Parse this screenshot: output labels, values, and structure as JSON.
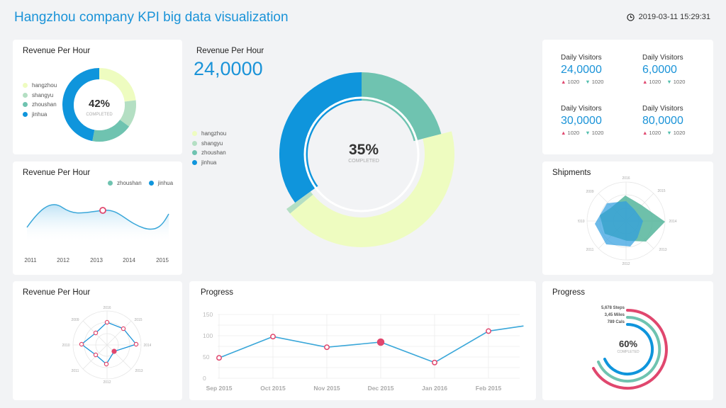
{
  "header": {
    "title": "Hangzhou company KPI big data visualization",
    "datetime": "2019-03-11 15:29:31"
  },
  "colors": {
    "hangzhou": "#eefcc0",
    "shangyu": "#b4dfc3",
    "zhoushan": "#6fc3b0",
    "jinhua": "#0f95dc",
    "accent": "#1a93d8",
    "pink": "#e0476e"
  },
  "legend": [
    "hangzhou",
    "shangyu",
    "zhoushan",
    "jinhua"
  ],
  "card_donut_small": {
    "title": "Revenue Per Hour",
    "percent": "42%",
    "caption": "COMPLETED",
    "chart_data": {
      "type": "pie",
      "labels": [
        "hangzhou",
        "shangyu",
        "zhoushan",
        "jinhua"
      ],
      "values": [
        23,
        12,
        18,
        47
      ]
    }
  },
  "card_area": {
    "title": "Revenue Per Hour",
    "legend": [
      "zhoushan",
      "jinhua"
    ],
    "x_labels": [
      "2011",
      "2012",
      "2013",
      "2014",
      "2015"
    ]
  },
  "card_radar_small": {
    "title": "Revenue Per Hour",
    "axis_labels": [
      "2016",
      "2015",
      "2014",
      "2013",
      "2012",
      "2011",
      "2010",
      "2009"
    ]
  },
  "card_main": {
    "title": "Revenue Per Hour",
    "value": "24,0000",
    "percent": "35%",
    "caption": "COMPLETED",
    "chart_data": {
      "type": "pie",
      "labels": [
        "hangzhou",
        "shangyu",
        "zhoushan",
        "jinhua"
      ],
      "values": [
        43,
        1,
        21,
        35
      ]
    }
  },
  "card_stats": {
    "items": [
      {
        "label": "Daily Visitors",
        "value": "24,0000",
        "up": "1020",
        "down": "1020"
      },
      {
        "label": "Daily Visitors",
        "value": "6,0000",
        "up": "1020",
        "down": "1020"
      },
      {
        "label": "Daily Visitors",
        "value": "30,0000",
        "up": "1020",
        "down": "1020"
      },
      {
        "label": "Daily Visitors",
        "value": "80,0000",
        "up": "1020",
        "down": "1020"
      }
    ]
  },
  "card_shipments": {
    "title": "Shipments",
    "axis_labels": [
      "2016",
      "2015",
      "2014",
      "2013",
      "2012",
      "2011",
      "2010",
      "2009"
    ]
  },
  "card_line": {
    "title": "Progress",
    "chart_data": {
      "type": "line",
      "categories": [
        "Sep 2015",
        "Oct 2015",
        "Nov 2015",
        "Dec 2015",
        "Jan 2016",
        "Feb 2015"
      ],
      "y_ticks": [
        "150",
        "100",
        "50",
        "0"
      ],
      "x": [
        0,
        1,
        2,
        3,
        4,
        5,
        5.65
      ],
      "values": [
        48,
        98,
        73,
        85,
        37,
        111,
        123
      ],
      "ylim": [
        0,
        150
      ]
    }
  },
  "card_progress": {
    "title": "Progress",
    "rings": [
      {
        "label": "5,678 Steps",
        "color": "#e0476e"
      },
      {
        "label": "3,45 Miles",
        "color": "#6fc3b0"
      },
      {
        "label": "789 Cals",
        "color": "#0f95dc"
      }
    ],
    "percent": "60%",
    "caption": "COMPLETED"
  }
}
